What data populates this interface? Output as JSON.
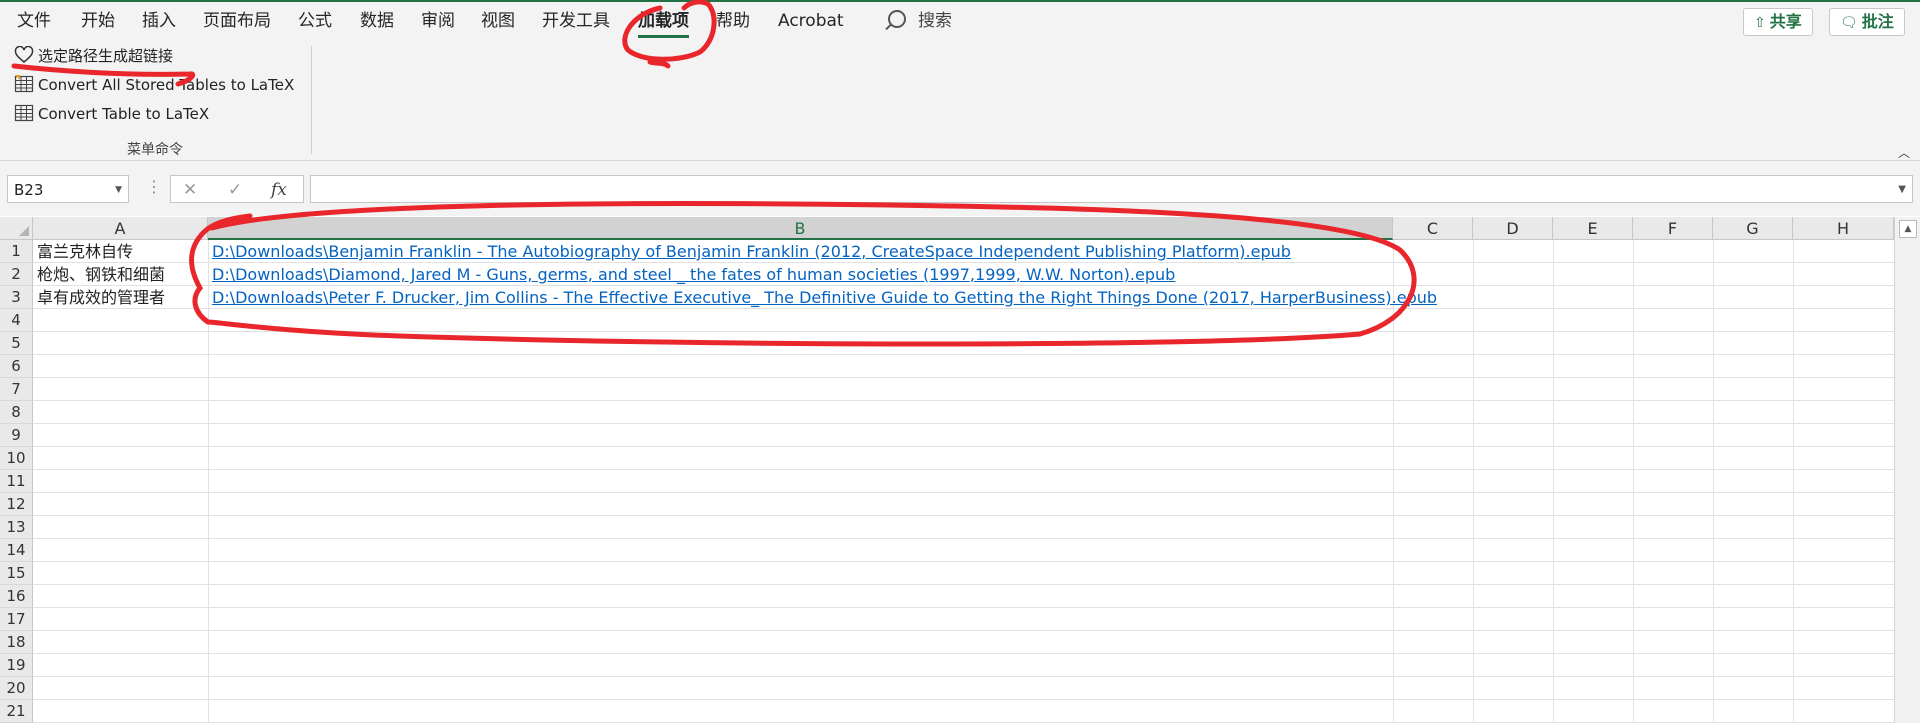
{
  "tabs": [
    "文件",
    "开始",
    "插入",
    "页面布局",
    "公式",
    "数据",
    "审阅",
    "视图",
    "开发工具",
    "加载项",
    "帮助",
    "Acrobat"
  ],
  "active_tab": "加载项",
  "search_label": "搜索",
  "share_label": "共享",
  "comment_label": "批注",
  "ribbon": {
    "items": [
      "选定路径生成超链接",
      "Convert All Stored Tables to LaTeX",
      "Convert Table to LaTeX"
    ],
    "group_label": "菜单命令"
  },
  "formula_bar": {
    "name_box": "B23",
    "formula": ""
  },
  "columns": [
    "A",
    "B",
    "C",
    "D",
    "E",
    "F",
    "G",
    "H"
  ],
  "selected_column": "B",
  "rows": [
    "1",
    "2",
    "3",
    "4",
    "5",
    "6",
    "7",
    "8",
    "9",
    "10",
    "11",
    "12",
    "13",
    "14",
    "15",
    "16",
    "17",
    "18",
    "19",
    "20",
    "21"
  ],
  "cells": [
    {
      "a": "富兰克林自传",
      "b": "D:\\Downloads\\Benjamin Franklin - The Autobiography of Benjamin Franklin (2012, CreateSpace Independent Publishing Platform).epub"
    },
    {
      "a": "枪炮、钢铁和细菌",
      "b": "D:\\Downloads\\Diamond, Jared M - Guns, germs, and steel _ the fates of human societies (1997,1999, W.W. Norton).epub"
    },
    {
      "a": "卓有成效的管理者",
      "b": "D:\\Downloads\\Peter F. Drucker, Jim Collins - The Effective Executive_ The Definitive Guide to Getting the Right Things Done (2017, HarperBusiness).epub"
    }
  ],
  "colors": {
    "accent": "#217346",
    "link": "#0563c1",
    "annotation": "#e8262b"
  }
}
